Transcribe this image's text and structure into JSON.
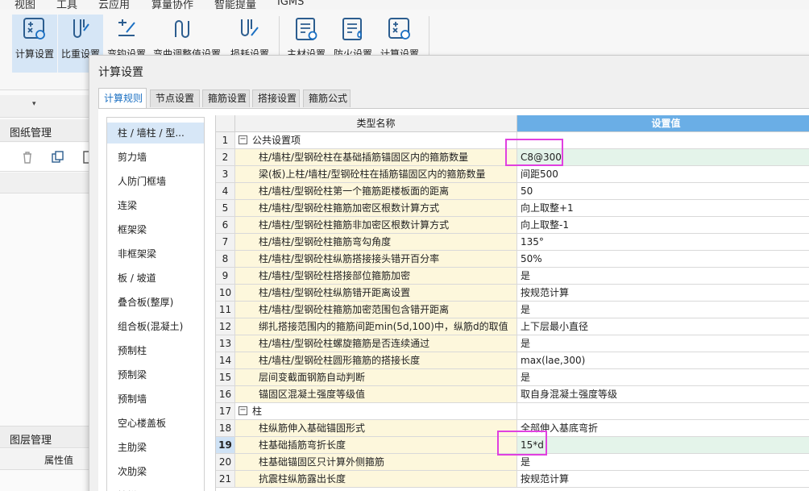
{
  "menu": [
    "视图",
    "工具",
    "云应用",
    "算量协作",
    "智能提量",
    "IGMS"
  ],
  "ribbon": {
    "buttons": [
      {
        "label": "计算设置",
        "active": true
      },
      {
        "label": "比重设置",
        "active": true
      },
      {
        "label": "弯钩设置",
        "active": false
      },
      {
        "label": "弯曲调整值设置",
        "active": false
      },
      {
        "label": "损耗设置",
        "active": false
      },
      {
        "label": "主材设置",
        "active": false
      },
      {
        "label": "防火设置",
        "active": false
      },
      {
        "label": "计算设置",
        "active": false
      }
    ]
  },
  "left_panel": {
    "drawing_manager": "图纸管理",
    "layer_manager": "图层管理",
    "property_value": "属性值"
  },
  "dialog": {
    "title": "计算设置",
    "tabs": [
      "计算规则",
      "节点设置",
      "箍筋设置",
      "搭接设置",
      "箍筋公式"
    ],
    "active_tab": 0,
    "categories": [
      "柱 / 墙柱 / 型...",
      "剪力墙",
      "人防门框墙",
      "连梁",
      "框架梁",
      "非框架梁",
      "板 / 坡道",
      "叠合板(整厚)",
      "组合板(混凝土)",
      "预制柱",
      "预制梁",
      "预制墙",
      "空心楼盖板",
      "主肋梁",
      "次肋梁",
      "楼梯"
    ],
    "selected_category": 0,
    "grid": {
      "col_name": "类型名称",
      "col_value": "设置值",
      "current_row": 19,
      "rows": [
        {
          "n": "1",
          "name": "公共设置项",
          "value": "",
          "group": true
        },
        {
          "n": "2",
          "name": "柱/墙柱/型钢砼柱在基础插筋锚固区内的箍筋数量",
          "value": "C8@300",
          "hl": true
        },
        {
          "n": "3",
          "name": "梁(板)上柱/墙柱/型钢砼柱在插筋锚固区内的箍筋数量",
          "value": "间距500"
        },
        {
          "n": "4",
          "name": "柱/墙柱/型钢砼柱第一个箍筋距楼板面的距离",
          "value": "50"
        },
        {
          "n": "5",
          "name": "柱/墙柱/型钢砼柱箍筋加密区根数计算方式",
          "value": "向上取整+1"
        },
        {
          "n": "6",
          "name": "柱/墙柱/型钢砼柱箍筋非加密区根数计算方式",
          "value": "向上取整-1"
        },
        {
          "n": "7",
          "name": "柱/墙柱/型钢砼柱箍筋弯勾角度",
          "value": "135°"
        },
        {
          "n": "8",
          "name": "柱/墙柱/型钢砼柱纵筋搭接接头错开百分率",
          "value": "50%"
        },
        {
          "n": "9",
          "name": "柱/墙柱/型钢砼柱搭接部位箍筋加密",
          "value": "是"
        },
        {
          "n": "10",
          "name": "柱/墙柱/型钢砼柱纵筋错开距离设置",
          "value": "按规范计算"
        },
        {
          "n": "11",
          "name": "柱/墙柱/型钢砼柱箍筋加密范围包含错开距离",
          "value": "是"
        },
        {
          "n": "12",
          "name": "绑扎搭接范围内的箍筋间距min(5d,100)中，纵筋d的取值",
          "value": "上下层最小直径"
        },
        {
          "n": "13",
          "name": "柱/墙柱/型钢砼柱螺旋箍筋是否连续通过",
          "value": "是"
        },
        {
          "n": "14",
          "name": "柱/墙柱/型钢砼柱圆形箍筋的搭接长度",
          "value": "max(lae,300)"
        },
        {
          "n": "15",
          "name": "层间变截面钢筋自动判断",
          "value": "是"
        },
        {
          "n": "16",
          "name": "锚固区混凝土强度等级值",
          "value": "取自身混凝土强度等级"
        },
        {
          "n": "17",
          "name": "柱",
          "value": "",
          "group": true
        },
        {
          "n": "18",
          "name": "柱纵筋伸入基础锚固形式",
          "value": "全部伸入基底弯折"
        },
        {
          "n": "19",
          "name": "柱基础插筋弯折长度",
          "value": "15*d",
          "hl": true
        },
        {
          "n": "20",
          "name": "柱基础锚固区只计算外侧箍筋",
          "value": "是"
        },
        {
          "n": "21",
          "name": "抗震柱纵筋露出长度",
          "value": "按规范计算"
        }
      ]
    }
  },
  "colors": {
    "accent": "#1a6fc2",
    "header_value": "#6aaee6",
    "name_cell": "#fdf7dc",
    "highlight_value": "#e4f4ea",
    "annotation": "#e040e0"
  }
}
